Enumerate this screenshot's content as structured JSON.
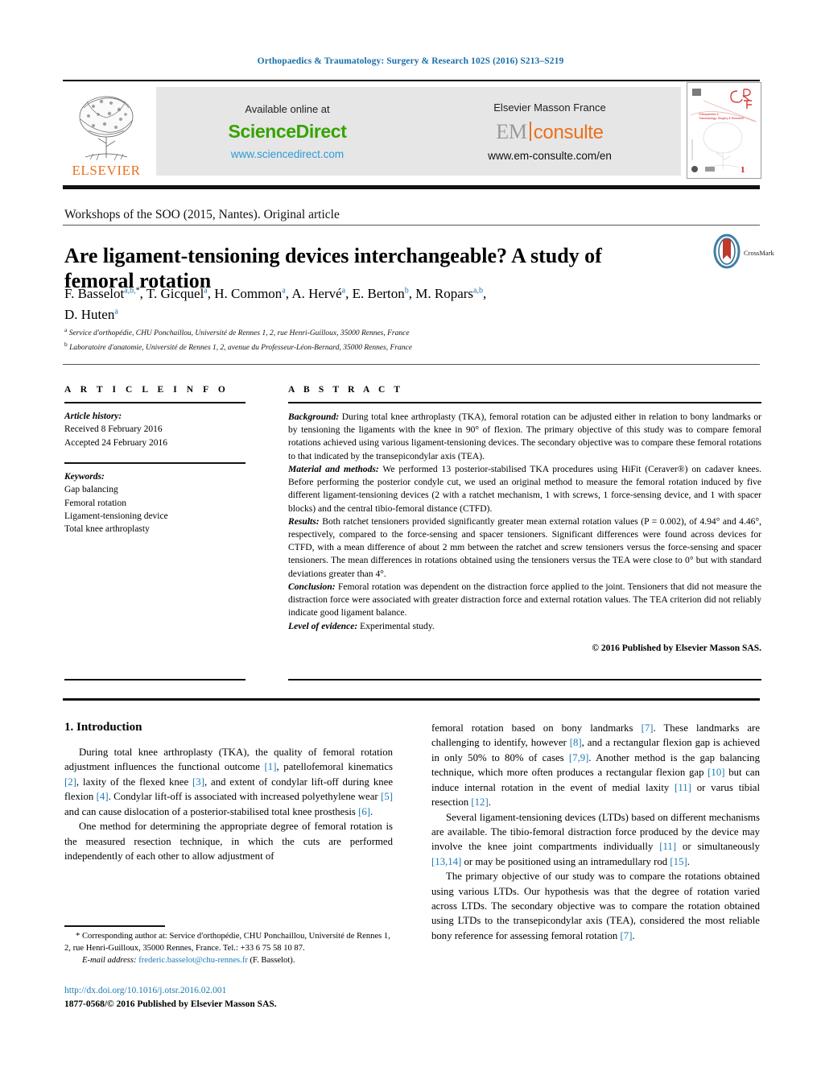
{
  "running_head": "Orthopaedics & Traumatology: Surgery & Research 102S (2016) S213–S219",
  "masthead": {
    "elsevier_wordmark": "ELSEVIER",
    "sciencedirect": {
      "available_label": "Available online at",
      "brand": "ScienceDirect",
      "url": "www.sciencedirect.com"
    },
    "emconsulte": {
      "publisher_label": "Elsevier Masson France",
      "brand_em": "EM",
      "brand_consulte": "consulte",
      "url": "www.em-consulte.com/en"
    },
    "cover_caption": "Orthopaedics & Traumatology: Surgery & Research",
    "cover_volume": "1"
  },
  "section_kind": "Workshops of the SOO (2015, Nantes). Original article",
  "title": "Are ligament-tensioning devices interchangeable? A study of femoral rotation",
  "crossmark_label": "CrossMark",
  "authors_line_1": "F. Basselot",
  "authors_html": "F. Basselot<sup>a,b,</sup><sup class=\"star\">*</sup>, T. Gicquel<sup>a</sup>, H. Common<sup>a</sup>, A. Hervé<sup>a</sup>, E. Berton<sup>b</sup>, M. Ropars<sup>a,b</sup>,<br>D. Huten<sup>a</sup>",
  "affiliations": [
    {
      "marker": "a",
      "text": "Service d'orthopédie, CHU Ponchaillou, Université de Rennes 1, 2, rue Henri-Guilloux, 35000 Rennes, France"
    },
    {
      "marker": "b",
      "text": "Laboratoire d'anatomie, Université de Rennes 1, 2, avenue du Professeur-Léon-Bernard, 35000 Rennes, France"
    }
  ],
  "article_info": {
    "heading": "A R T I C L E   I N F O",
    "history_label": "Article history:",
    "history": [
      "Received 8 February 2016",
      "Accepted 24 February 2016"
    ],
    "keywords_label": "Keywords:",
    "keywords": [
      "Gap balancing",
      "Femoral rotation",
      "Ligament-tensioning device",
      "Total knee arthroplasty"
    ]
  },
  "abstract": {
    "heading": "A B S T R A C T",
    "background_label": "Background:",
    "background": "During total knee arthroplasty (TKA), femoral rotation can be adjusted either in relation to bony landmarks or by tensioning the ligaments with the knee in 90° of flexion. The primary objective of this study was to compare femoral rotations achieved using various ligament-tensioning devices. The secondary objective was to compare these femoral rotations to that indicated by the transepicondylar axis (TEA).",
    "methods_label": "Material and methods:",
    "methods": "We performed 13 posterior-stabilised TKA procedures using HiFit (Ceraver®) on cadaver knees. Before performing the posterior condyle cut, we used an original method to measure the femoral rotation induced by five different ligament-tensioning devices (2 with a ratchet mechanism, 1 with screws, 1 force-sensing device, and 1 with spacer blocks) and the central tibio-femoral distance (CTFD).",
    "results_label": "Results:",
    "results": "Both ratchet tensioners provided significantly greater mean external rotation values (P = 0.002), of 4.94° and 4.46°, respectively, compared to the force-sensing and spacer tensioners. Significant differences were found across devices for CTFD, with a mean difference of about 2 mm between the ratchet and screw tensioners versus the force-sensing and spacer tensioners. The mean differences in rotations obtained using the tensioners versus the TEA were close to 0° but with standard deviations greater than 4°.",
    "conclusion_label": "Conclusion:",
    "conclusion": "Femoral rotation was dependent on the distraction force applied to the joint. Tensioners that did not measure the distraction force were associated with greater distraction force and external rotation values. The TEA criterion did not reliably indicate good ligament balance.",
    "evidence_label": "Level of evidence:",
    "evidence": "Experimental study.",
    "copyright": "© 2016 Published by Elsevier Masson SAS."
  },
  "body": {
    "section_number_title": "1. Introduction",
    "left_paragraphs": [
      "During total knee arthroplasty (TKA), the quality of femoral rotation adjustment influences the functional outcome [1], patellofemoral kinematics [2], laxity of the flexed knee [3], and extent of condylar lift-off during knee flexion [4]. Condylar lift-off is associated with increased polyethylene wear [5] and can cause dislocation of a posterior-stabilised total knee prosthesis [6].",
      "One method for determining the appropriate degree of femoral rotation is the measured resection technique, in which the cuts are performed independently of each other to allow adjustment of"
    ],
    "right_paragraphs": [
      "femoral rotation based on bony landmarks [7]. These landmarks are challenging to identify, however [8], and a rectangular flexion gap is achieved in only 50% to 80% of cases [7,9]. Another method is the gap balancing technique, which more often produces a rectangular flexion gap [10] but can induce internal rotation in the event of medial laxity [11] or varus tibial resection [12].",
      "Several ligament-tensioning devices (LTDs) based on different mechanisms are available. The tibio-femoral distraction force produced by the device may involve the knee joint compartments individually [11] or simultaneously [13,14] or may be positioned using an intramedullary rod [15].",
      "The primary objective of our study was to compare the rotations obtained using various LTDs. Our hypothesis was that the degree of rotation varied across LTDs. The secondary objective was to compare the rotation obtained using LTDs to the transepicondylar axis (TEA), considered the most reliable bony reference for assessing femoral rotation [7]."
    ]
  },
  "footnote": {
    "star": "*",
    "corresponding": "Corresponding author at: Service d'orthopédie, CHU Ponchaillou, Université de Rennes 1, 2, rue Henri-Guilloux, 35000 Rennes, France. Tel.: +33 6 75 58 10 87.",
    "email_label": "E-mail address:",
    "email": "frederic.basselot@chu-rennes.fr",
    "email_owner": "(F. Basselot)."
  },
  "footer": {
    "doi": "http://dx.doi.org/10.1016/j.otsr.2016.02.001",
    "issn_line": "1877-0568/© 2016 Published by Elsevier Masson SAS."
  }
}
